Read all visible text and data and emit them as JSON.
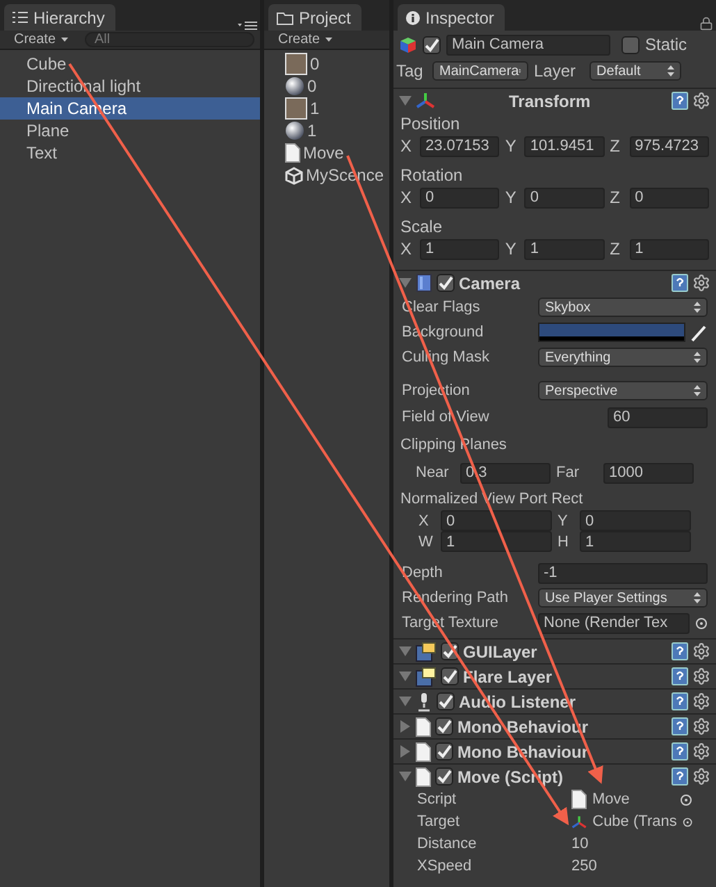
{
  "hierarchy": {
    "title": "Hierarchy",
    "create": "Create",
    "search_placeholder": "All",
    "items": [
      {
        "label": "Cube",
        "selected": false
      },
      {
        "label": "Directional light",
        "selected": false
      },
      {
        "label": "Main Camera",
        "selected": true
      },
      {
        "label": "Plane",
        "selected": false
      },
      {
        "label": "Text",
        "selected": false
      }
    ]
  },
  "project": {
    "title": "Project",
    "create": "Create",
    "items": [
      {
        "label": "0",
        "kind": "texture"
      },
      {
        "label": "0",
        "kind": "material"
      },
      {
        "label": "1",
        "kind": "texture"
      },
      {
        "label": "1",
        "kind": "material"
      },
      {
        "label": "Move",
        "kind": "script"
      },
      {
        "label": "MyScence",
        "kind": "scene"
      }
    ]
  },
  "inspector": {
    "title": "Inspector",
    "object_name": "Main Camera",
    "active": true,
    "static_label": "Static",
    "static": false,
    "tag_label": "Tag",
    "tag": "MainCamera",
    "layer_label": "Layer",
    "layer": "Default",
    "components": [
      {
        "name": "Transform",
        "kind": "transform",
        "expanded": true,
        "properties": [
          {
            "kind": "vector",
            "label": "Position",
            "fields": [
              {
                "axis": "X",
                "value": "23.07153"
              },
              {
                "axis": "Y",
                "value": "101.9451"
              },
              {
                "axis": "Z",
                "value": "975.4723"
              }
            ]
          },
          {
            "kind": "vector",
            "label": "Rotation",
            "fields": [
              {
                "axis": "X",
                "value": "0"
              },
              {
                "axis": "Y",
                "value": "0"
              },
              {
                "axis": "Z",
                "value": "0"
              }
            ]
          },
          {
            "kind": "vector",
            "label": "Scale",
            "fields": [
              {
                "axis": "X",
                "value": "1"
              },
              {
                "axis": "Y",
                "value": "1"
              },
              {
                "axis": "Z",
                "value": "1"
              }
            ]
          }
        ]
      },
      {
        "name": "Camera",
        "kind": "camera",
        "enabled": true,
        "expanded": true,
        "properties": [
          {
            "kind": "dropdown",
            "label": "Clear Flags",
            "value": "Skybox"
          },
          {
            "kind": "color",
            "label": "Background",
            "color": "#2d4a7c"
          },
          {
            "kind": "dropdown",
            "label": "Culling Mask",
            "value": "Everything"
          },
          {
            "kind": "dropdown",
            "label": "Projection",
            "value": "Perspective"
          },
          {
            "kind": "number",
            "label": "Field of View",
            "value": "60"
          },
          {
            "kind": "pair",
            "label": "Clipping Planes",
            "fields": [
              {
                "axis": "Near",
                "value": "0.3"
              },
              {
                "axis": "Far",
                "value": "1000"
              }
            ]
          },
          {
            "kind": "rect",
            "label": "Normalized View Port Rect",
            "fields": [
              {
                "axis": "X",
                "value": "0"
              },
              {
                "axis": "Y",
                "value": "0"
              },
              {
                "axis": "W",
                "value": "1"
              },
              {
                "axis": "H",
                "value": "1"
              }
            ]
          },
          {
            "kind": "wide",
            "label": "Depth",
            "value": "-1"
          },
          {
            "kind": "dropdown",
            "label": "Rendering Path",
            "value": "Use Player Settings"
          },
          {
            "kind": "object",
            "label": "Target Texture",
            "value": "None (Render Tex"
          }
        ]
      },
      {
        "name": "GUILayer",
        "kind": "guilayer",
        "enabled": true,
        "expanded": true
      },
      {
        "name": "Flare Layer",
        "kind": "flare",
        "enabled": true,
        "expanded": true
      },
      {
        "name": "Audio Listener",
        "kind": "audio",
        "enabled": true,
        "expanded": true
      },
      {
        "name": "Mono Behaviour",
        "kind": "script",
        "enabled": true,
        "expanded": false
      },
      {
        "name": "Mono Behaviour",
        "kind": "script",
        "enabled": true,
        "expanded": false
      },
      {
        "name": "Move (Script)",
        "kind": "script",
        "enabled": true,
        "expanded": true,
        "properties": [
          {
            "kind": "script_reference",
            "label": "Script",
            "value": "Move"
          },
          {
            "kind": "object_reference",
            "label": "Target",
            "value": "Cube (Trans"
          },
          {
            "kind": "plain",
            "label": "Distance",
            "value": "10"
          },
          {
            "kind": "plain",
            "label": "XSpeed",
            "value": "250"
          }
        ]
      }
    ]
  }
}
